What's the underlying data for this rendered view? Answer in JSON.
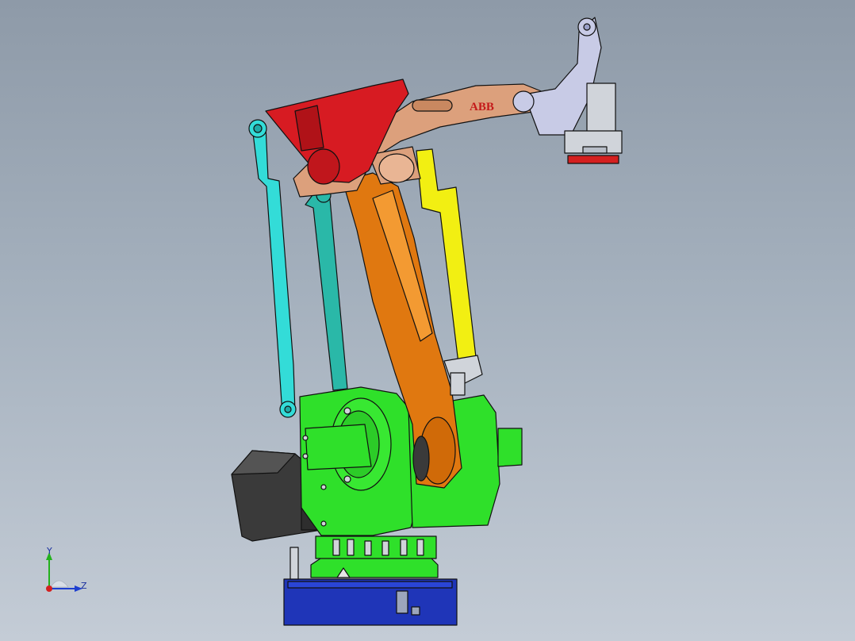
{
  "model": {
    "brand_label": "ABB",
    "colors": {
      "background_top": "#8e9aa8",
      "background_bottom": "#c4ccd6",
      "base_plate": "#1f35b8",
      "base_body": "#2fe02a",
      "motor": "#3a3a3a",
      "upper_arm": "#e07810",
      "cylinder": "#f2ef12",
      "rear_link_outer": "#33dcd8",
      "rear_link_inner": "#2ab8a8",
      "rocker": "#d71b22",
      "forearm": "#dca07c",
      "wrist": "#c8cbe6",
      "flange": "#d0d4da",
      "tool_flange_ring": "#d42020"
    }
  },
  "triad": {
    "y_label": "Y",
    "z_label": "Z",
    "colors": {
      "y": "#23b11d",
      "z": "#1e3fcf",
      "x": "#d42020"
    }
  }
}
